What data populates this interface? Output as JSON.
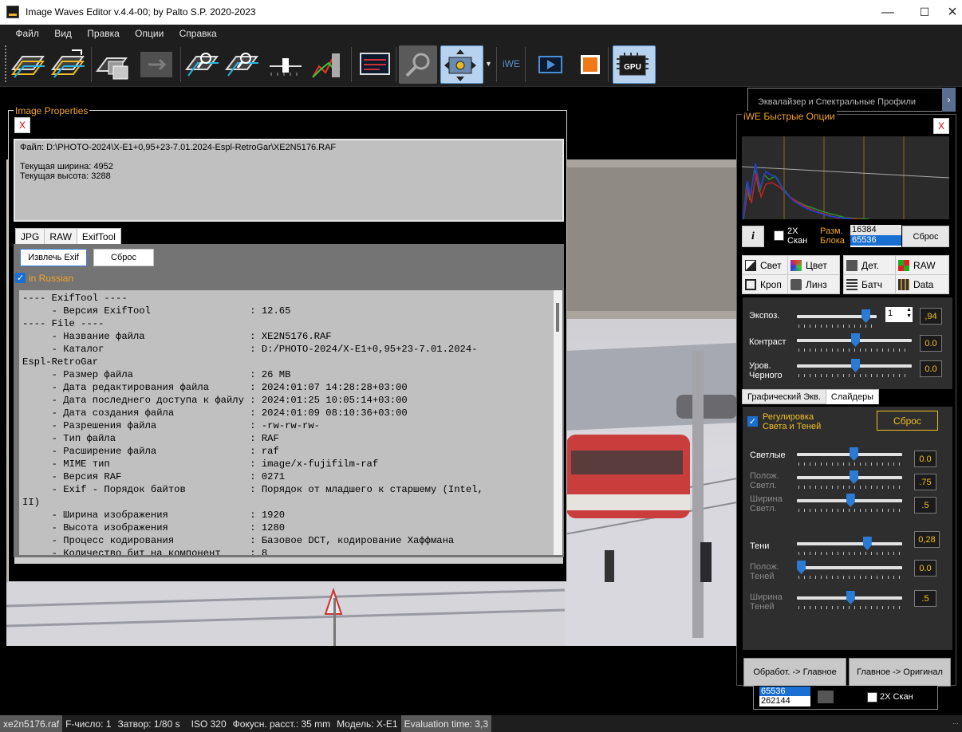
{
  "window": {
    "title": "Image Waves Editor  v.4.4-00; by Palto S.P.  2020-2023"
  },
  "menu": [
    "Файл",
    "Вид",
    "Правка",
    "Опции",
    "Справка"
  ],
  "toolbar": {
    "iwe_label": "iWE",
    "gpu_label": "GPU"
  },
  "properties": {
    "title": "Image Properties",
    "close": "X",
    "file_line": "Файл: D:\\PHOTO-2024\\X-E1+0,95+23-7.01.2024-Espl-RetroGar\\XE2N5176.RAF",
    "width_line": "Текущая ширина: 4952",
    "height_line": "Текущая высота: 3288",
    "tabs": [
      "JPG",
      "RAW",
      "ExifTool"
    ],
    "extract_button": "Извлечь  Exif",
    "reset_button": "Сброс",
    "russian_label": "in Russian",
    "exif_lines": [
      "---- ExifTool ----",
      "     - Версия ExifTool                 : 12.65",
      "---- File ----",
      "     - Название файла                  : XE2N5176.RAF",
      "     - Каталог                         : D:/PHOTO-2024/X-E1+0,95+23-7.01.2024-",
      "Espl-RetroGar",
      "     - Размер файла                    : 26 MB",
      "     - Дата редактирования файла       : 2024:01:07 14:28:28+03:00",
      "     - Дата последнего доступа к файлу : 2024:01:25 10:05:14+03:00",
      "     - Дата создания файла             : 2024:01:09 08:10:36+03:00",
      "     - Разрешения файла                : -rw-rw-rw-",
      "     - Тип файла                       : RAF",
      "     - Расширение файла                : raf",
      "     - MIME тип                        : image/x-fujifilm-raf",
      "     - Версия RAF                      : 0271",
      "     - Exif - Порядок байтов           : Порядок от младшего к старшему (Intel,",
      "II)",
      "     - Ширина изображения              : 1920",
      "     - Высота изображения              : 1280",
      "     - Процесс кодирования             : Базовое DCT, кодирование Хаффмана",
      "     - Количество бит на компонент     : 8"
    ]
  },
  "eq_bar": {
    "label": "Эквалайзер и Спектральные Профили",
    "arrow": "›"
  },
  "iwe": {
    "title": "iWE Быстрые Опции",
    "close": "X",
    "info_button": "i",
    "scan2x_line1": "2X",
    "scan2x_line2": "Скан",
    "block_line1": "Разм.",
    "block_line2": "Блока",
    "block_values": [
      "16384",
      "65536"
    ],
    "reset_button": "Сброс",
    "modes": [
      "Свет",
      "Цвет",
      "Дет.",
      "RAW",
      "Кроп",
      "Линз",
      "Батч",
      "Data"
    ],
    "exposure": {
      "label": "Экспоз.",
      "spin": "1",
      "value": ",94",
      "level": 0.85
    },
    "contrast": {
      "label": "Контраст",
      "value": "0.0",
      "level": 0.5
    },
    "black": {
      "label1": "Уров.",
      "label2": "Черного",
      "value": "0.0",
      "level": 0.5
    },
    "subtabs": [
      "Графический Экв.",
      "Слайдеры"
    ],
    "shadow_toggle_1": "Регулировка",
    "shadow_toggle_2": "Света и Теней",
    "reset2": "Сброс",
    "highlights": {
      "label": "Светлые",
      "value": "0.0",
      "level": 0.5
    },
    "hl_pos": {
      "label1": "Полож.",
      "label2": "Светл.",
      "value": ".75",
      "level": 0.5
    },
    "hl_width": {
      "label1": "Ширина",
      "label2": "Светл.",
      "value": ".5",
      "level": 0.47
    },
    "shadows": {
      "label": "Тени",
      "value": "0,28",
      "level": 0.62
    },
    "sh_pos": {
      "label1": "Полож.",
      "label2": "Теней",
      "value": "0.0",
      "level": 0.0
    },
    "sh_width": {
      "label1": "Ширина",
      "label2": "Теней",
      "value": ".5",
      "level": 0.47
    },
    "btn_process": "Обработ. -> Главное",
    "btn_original": "Главное -> Оригинал"
  },
  "behind": {
    "values": [
      "65536",
      "262144"
    ],
    "scan2x": "2X Скан"
  },
  "status": {
    "file": "xe2n5176.raf",
    "fnumber": "F-число: 1",
    "shutter": "Затвор:  1/80 s",
    "iso": "ISO 320",
    "focal": "Фокусн. расст.: 35 mm",
    "model": "Модель: X-E1",
    "eval": "Evaluation time: 3,3"
  },
  "colors": {
    "accent": "#f0a429",
    "value_yellow": "#f0c020",
    "selection_blue": "#1a6fd2"
  }
}
